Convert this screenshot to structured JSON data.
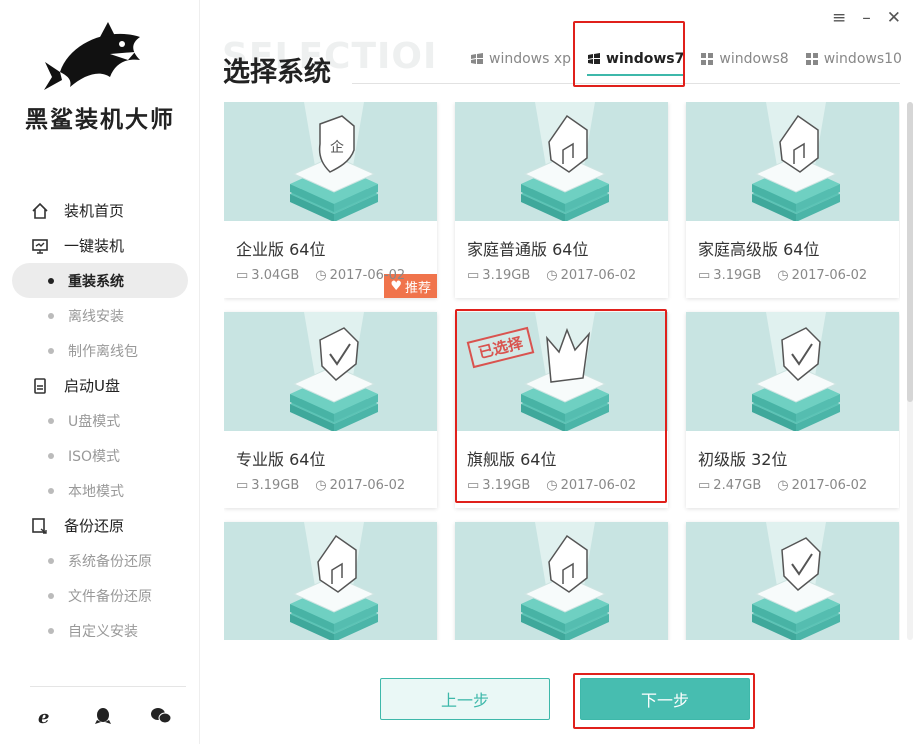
{
  "window": {
    "menu_glyph": "≡",
    "minimize_glyph": "–",
    "close_glyph": "✕"
  },
  "brand": {
    "name": "黑鲨装机大师"
  },
  "nav": [
    {
      "type": "item",
      "label": "装机首页",
      "icon": "home-icon"
    },
    {
      "type": "item",
      "label": "一键装机",
      "icon": "monitor-icon"
    },
    {
      "type": "sub",
      "label": "重装系统",
      "active": true
    },
    {
      "type": "sub",
      "label": "离线安装"
    },
    {
      "type": "sub",
      "label": "制作离线包"
    },
    {
      "type": "item",
      "label": "启动U盘",
      "icon": "usb-drive-icon"
    },
    {
      "type": "sub",
      "label": "U盘模式"
    },
    {
      "type": "sub",
      "label": "ISO模式"
    },
    {
      "type": "sub",
      "label": "本地模式"
    },
    {
      "type": "item",
      "label": "备份还原",
      "icon": "backup-icon"
    },
    {
      "type": "sub",
      "label": "系统备份还原"
    },
    {
      "type": "sub",
      "label": "文件备份还原"
    },
    {
      "type": "sub",
      "label": "自定义安装"
    }
  ],
  "header": {
    "ghost_text": "SELECTIOI",
    "title": "选择系统"
  },
  "tabs": [
    {
      "label": "windows xp",
      "active": false
    },
    {
      "label": "windows7",
      "active": true
    },
    {
      "label": "windows8",
      "active": false
    },
    {
      "label": "windows10",
      "active": false
    }
  ],
  "cards": [
    {
      "name": "企业版 64位",
      "size": "3.04GB",
      "date": "2017-06-02",
      "badge": "推荐",
      "art": "shield"
    },
    {
      "name": "家庭普通版 64位",
      "size": "3.19GB",
      "date": "2017-06-02",
      "art": "house"
    },
    {
      "name": "家庭高级版 64位",
      "size": "3.19GB",
      "date": "2017-06-02",
      "art": "house"
    },
    {
      "name": "专业版 64位",
      "size": "3.19GB",
      "date": "2017-06-02",
      "art": "check"
    },
    {
      "name": "旗舰版 64位",
      "size": "3.19GB",
      "date": "2017-06-02",
      "selected": true,
      "stamp": "已选择",
      "art": "crown"
    },
    {
      "name": "初级版 32位",
      "size": "2.47GB",
      "date": "2017-06-02",
      "art": "check"
    },
    {
      "name": "",
      "size": "",
      "date": "",
      "art": "house"
    },
    {
      "name": "",
      "size": "",
      "date": "",
      "art": "house"
    },
    {
      "name": "",
      "size": "",
      "date": "",
      "art": "check"
    }
  ],
  "buttons": {
    "prev": "上一步",
    "next": "下一步"
  },
  "colors": {
    "accent": "#47bdb0",
    "highlight": "#e0201b",
    "badge": "#f0744c",
    "thumb_bg": "#c8e4e2"
  }
}
